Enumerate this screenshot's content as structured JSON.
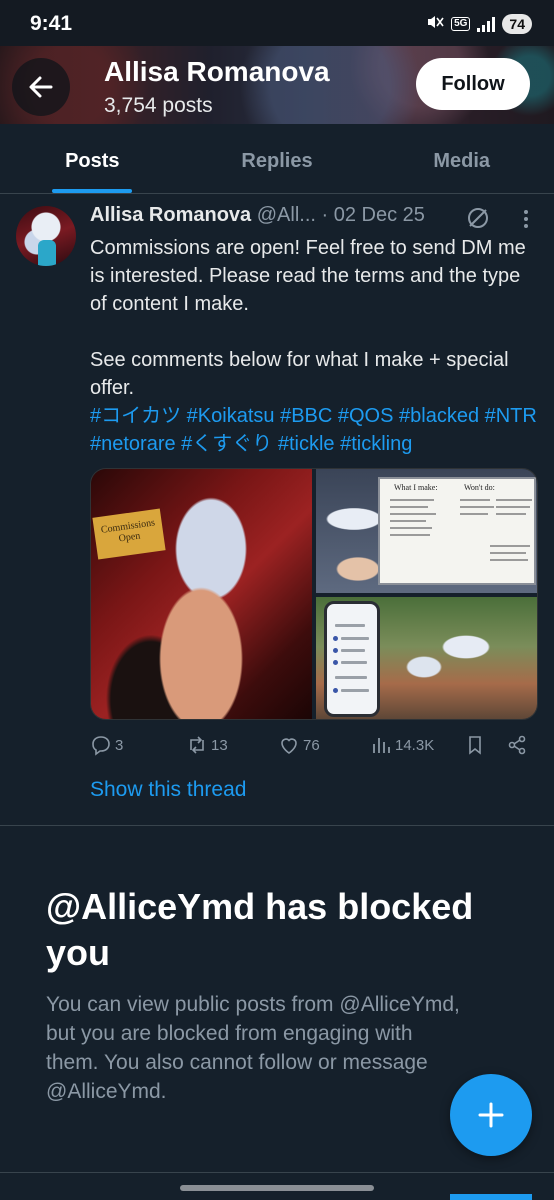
{
  "status_bar": {
    "time": "9:41",
    "network": "5G",
    "battery": "74"
  },
  "header": {
    "title": "Allisa Romanova",
    "subtitle": "3,754 posts",
    "follow_label": "Follow"
  },
  "tabs": [
    {
      "label": "Posts",
      "active": true
    },
    {
      "label": "Replies",
      "active": false
    },
    {
      "label": "Media",
      "active": false
    }
  ],
  "post": {
    "author_name": "Allisa Romanova",
    "author_handle": "@All...",
    "separator": "·",
    "date": "02 Dec 25",
    "text_paragraph_1": "Commissions are open! Feel free to send DM me is interested. Please read the terms and the type of content I make.",
    "text_paragraph_2": "See comments below for what I make + special offer.",
    "hashtags": "#コイカツ #Koikatsu #BBC #QOS #blacked #NTR #netorare #くすぐり #tickle #tickling",
    "image_sign_text": "Commissions Open",
    "board_heading_left": "What I make:",
    "board_heading_right": "Won't do:",
    "replies": "3",
    "reposts": "13",
    "likes": "76",
    "views": "14.3K",
    "show_thread_label": "Show this thread"
  },
  "blocked": {
    "title": "@AlliceYmd has blocked you",
    "text": "You can view public posts from @AlliceYmd, but you are blocked from engaging with them. You also cannot follow or message @AlliceYmd."
  },
  "colors": {
    "background": "#15202b",
    "accent": "#1d9bf0",
    "muted": "#8b98a5",
    "divider": "#38444d"
  }
}
